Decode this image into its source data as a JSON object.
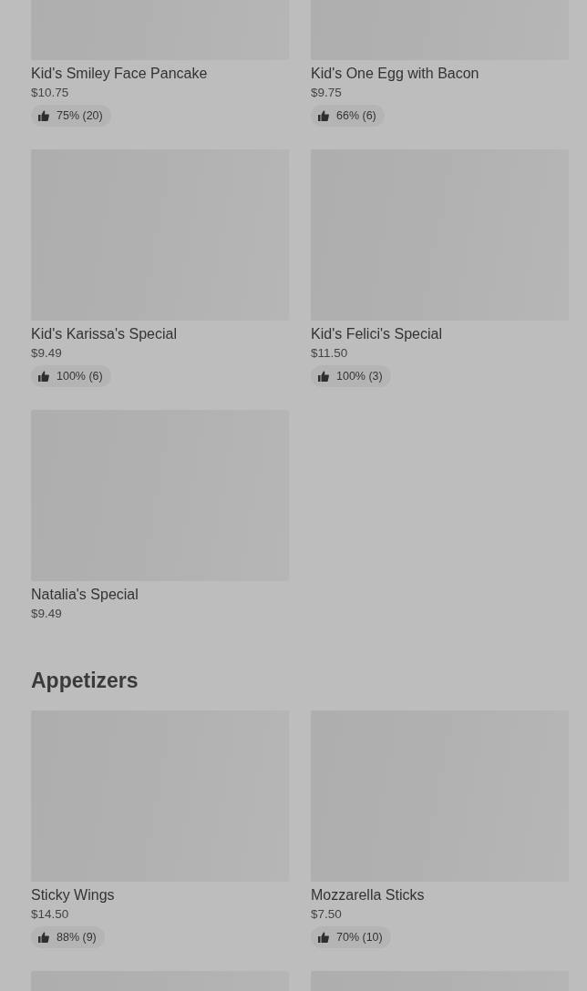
{
  "sections": [
    {
      "items": [
        {
          "kind": "dish",
          "name": "Kid's Smiley Face Pancake",
          "price": "$10.75",
          "rating": "75% (20)"
        },
        {
          "kind": "dish",
          "name": "Kid's One Egg with Bacon",
          "price": "$9.75",
          "rating": "66% (6)"
        },
        {
          "kind": "dish",
          "name": "Kid's Karissa's Special",
          "price": "$9.49",
          "rating": "100% (6)"
        },
        {
          "kind": "dish",
          "name": "Kid's Felici's Special",
          "price": "$11.50",
          "rating": "100% (3)"
        },
        {
          "kind": "dish",
          "name": "Natalia's Special",
          "price": "$9.49"
        }
      ]
    },
    {
      "title": "Appetizers",
      "items": [
        {
          "kind": "dish",
          "name": "Sticky Wings",
          "price": "$14.50",
          "rating": "88% (9)"
        },
        {
          "kind": "dish",
          "name": "Mozzarella Sticks",
          "price": "$7.50",
          "rating": "70% (10)"
        },
        {
          "kind": "image_only"
        },
        {
          "kind": "image_only"
        }
      ]
    }
  ]
}
